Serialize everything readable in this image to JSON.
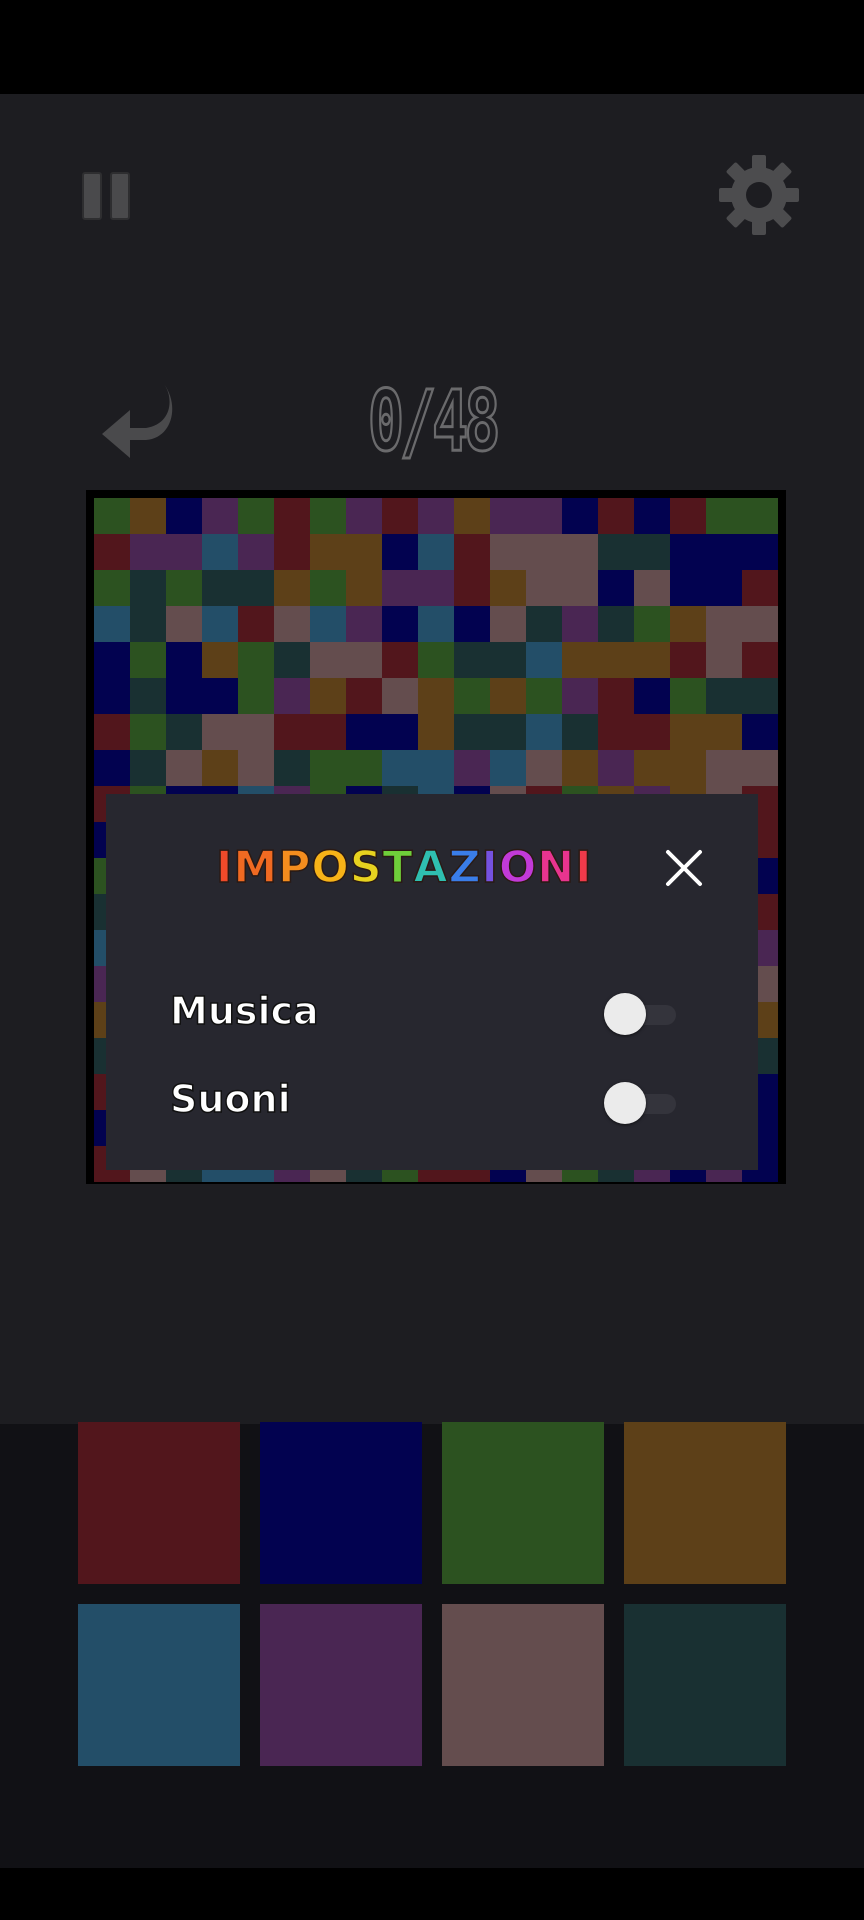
{
  "counter": "0/48",
  "settings_dialog": {
    "title": "IMPOSTAZIONI",
    "title_colors": [
      "#ef4a2a",
      "#f06a22",
      "#f48d1e",
      "#f7b318",
      "#e7d21f",
      "#6fcf3a",
      "#2fbfb0",
      "#3a7de8",
      "#7552e0",
      "#c23ad8",
      "#e8348f",
      "#ef3a4a"
    ],
    "items": [
      {
        "label": "Musica",
        "on": false
      },
      {
        "label": "Suoni",
        "on": false
      }
    ]
  },
  "palette": {
    "row1": [
      "#52161c",
      "#020250",
      "#2c5220",
      "#5d4018"
    ],
    "row2": [
      "#234e68",
      "#4a2653",
      "#644d4e",
      "#193032"
    ]
  },
  "board": {
    "size": 19,
    "color_key": {
      "R": "#52161c",
      "B": "#020250",
      "G": "#2c5220",
      "O": "#5d4018",
      "T": "#234e68",
      "P": "#4a2653",
      "K": "#644d4e",
      "D": "#193032"
    },
    "rows": [
      "GOBPGRGPRPOPPBRBRGG",
      "RPPTPROOBTRKKKDDBBB",
      "GDGDDOGOPPROKKBKBBR",
      "TDKTRKTPBTBKDPDGOKK",
      "BGBOGDKKRGDDTOOORKR",
      "BDBBGPORKOGOGPRBGDD",
      "RGDKKRRBBODDTDRROOB",
      "BDKOKDGGTTPTKOPOOKK",
      "RGBBTPGBDTBKRGOPOKR",
      "BDOKGPTRPBOKBGDTBRR",
      "GRBOBDGKGRKBTRPOGBB",
      "DTPGKRBTODGKPBOROTR",
      "TGROKBTRDBPGTKDOBPP",
      "PBTKGBRDPGTRBOKBTDK",
      "ODGBTPOKRTDBGPDOOTO",
      "DBPOBRKTDRGOTRBDPDD",
      "ROKTBDTPKRDBGKPRBPB",
      "BTKRODTPKDGRBTGKPOB",
      "RKDTTPKDGRRBKGDPBPB"
    ]
  }
}
